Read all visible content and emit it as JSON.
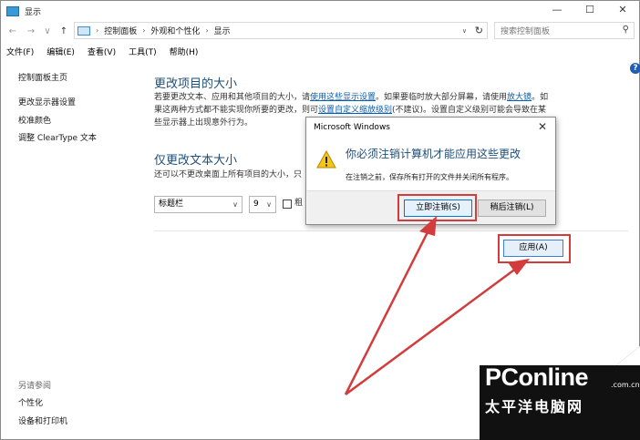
{
  "window": {
    "title": "显示",
    "controls": [
      "—",
      "☐",
      "✕"
    ]
  },
  "address": {
    "nav": {
      "back": "←",
      "forward": "→",
      "recent": "∨",
      "up": "↑"
    },
    "crumbs": [
      "控制面板",
      "外观和个性化",
      "显示"
    ],
    "separator": "›",
    "dropdown": "∨",
    "refresh": "↻",
    "search_placeholder": "搜索控制面板",
    "search_icon": "⚲"
  },
  "menu": [
    "文件(F)",
    "编辑(E)",
    "查看(V)",
    "工具(T)",
    "帮助(H)"
  ],
  "help_icon": "?",
  "sidebar": {
    "home": "控制面板主页",
    "links": [
      "更改显示器设置",
      "校准颜色",
      "调整 ClearType 文本"
    ],
    "see_also_title": "另请参阅",
    "see_also": [
      "个性化",
      "设备和打印机"
    ]
  },
  "main": {
    "section1_title": "更改项目的大小",
    "para1_line1_a": "若要更改文本、应用和其他项目的大小，请",
    "para1_link1": "使用这些显示设置",
    "para1_line1_b": "。如果要临时放大部分屏幕，请使用",
    "para1_link2": "放大镜",
    "para1_line1_c": "。如",
    "para1_line2_a": "果这两种方式都不能实现你所要的更改，则可",
    "para1_link3": "设置自定义缩放级别",
    "para1_line2_b": "(不建议)。设置自定义级别可能会导致在某",
    "para1_line3": "些显示器上出现意外行为。",
    "section2_title": "仅更改文本大小",
    "para2": "还可以不更改桌面上所有项目的大小，只",
    "item_select": "标题栏",
    "size_select": "9",
    "bold_label": "粗",
    "apply_button": "应用(A)"
  },
  "dialog": {
    "title": "Microsoft Windows",
    "close": "✕",
    "message": "你必须注销计算机才能应用这些更改",
    "detail": "在注销之前，保存所有打开的文件并关闭所有程序。",
    "sign_out_now": "立即注销(S)",
    "sign_out_later": "稍后注销(L)"
  },
  "watermark": {
    "logo": "PConline",
    "domain": ".com.cn",
    "subtitle": "太平洋电脑网"
  },
  "colors": {
    "heading": "#1e4e79",
    "link": "#0a5eb0",
    "highlight": "#d23c3c",
    "accent": "#0078d7"
  }
}
